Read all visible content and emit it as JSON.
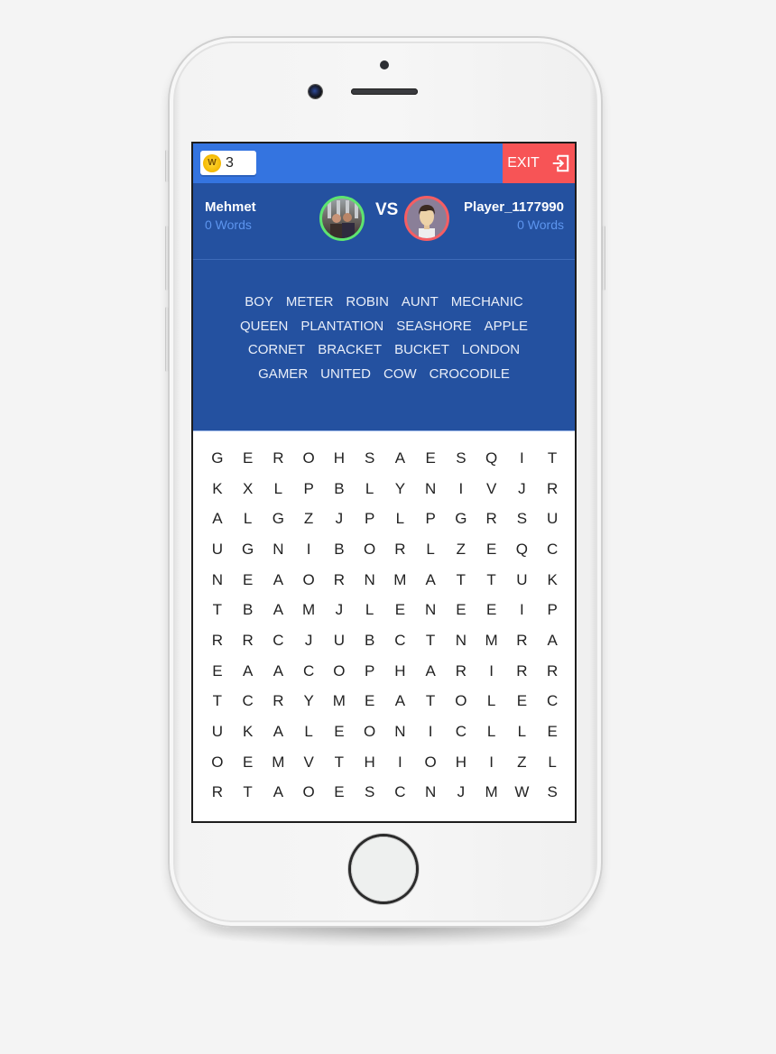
{
  "topbar": {
    "coins": "3",
    "coin_icon_letter": "W",
    "exit_label": "EXIT"
  },
  "players": {
    "left": {
      "name": "Mehmet",
      "words": "0 Words",
      "ring_color": "#5ee470"
    },
    "vs_label": "VS",
    "right": {
      "name": "Player_1177990",
      "words": "0 Words",
      "ring_color": "#f55e63"
    }
  },
  "word_list": [
    [
      "BOY",
      "METER",
      "ROBIN",
      "AUNT",
      "MECHANIC"
    ],
    [
      "QUEEN",
      "PLANTATION",
      "SEASHORE",
      "APPLE"
    ],
    [
      "CORNET",
      "BRACKET",
      "BUCKET",
      "LONDON"
    ],
    [
      "GAMER",
      "UNITED",
      "COW",
      "CROCODILE"
    ]
  ],
  "grid": [
    [
      "G",
      "E",
      "R",
      "O",
      "H",
      "S",
      "A",
      "E",
      "S",
      "Q",
      "I",
      "T"
    ],
    [
      "K",
      "X",
      "L",
      "P",
      "B",
      "L",
      "Y",
      "N",
      "I",
      "V",
      "J",
      "R"
    ],
    [
      "A",
      "L",
      "G",
      "Z",
      "J",
      "P",
      "L",
      "P",
      "G",
      "R",
      "S",
      "U"
    ],
    [
      "U",
      "G",
      "N",
      "I",
      "B",
      "O",
      "R",
      "L",
      "Z",
      "E",
      "Q",
      "C"
    ],
    [
      "N",
      "E",
      "A",
      "O",
      "R",
      "N",
      "M",
      "A",
      "T",
      "T",
      "U",
      "K"
    ],
    [
      "T",
      "B",
      "A",
      "M",
      "J",
      "L",
      "E",
      "N",
      "E",
      "E",
      "I",
      "P"
    ],
    [
      "R",
      "R",
      "C",
      "J",
      "U",
      "B",
      "C",
      "T",
      "N",
      "M",
      "R",
      "A"
    ],
    [
      "E",
      "A",
      "A",
      "C",
      "O",
      "P",
      "H",
      "A",
      "R",
      "I",
      "R",
      "R"
    ],
    [
      "T",
      "C",
      "R",
      "Y",
      "M",
      "E",
      "A",
      "T",
      "O",
      "L",
      "E",
      "C"
    ],
    [
      "U",
      "K",
      "A",
      "L",
      "E",
      "O",
      "N",
      "I",
      "C",
      "L",
      "L",
      "E"
    ],
    [
      "O",
      "E",
      "M",
      "V",
      "T",
      "H",
      "I",
      "O",
      "H",
      "I",
      "Z",
      "L"
    ],
    [
      "R",
      "T",
      "A",
      "O",
      "E",
      "S",
      "C",
      "N",
      "J",
      "M",
      "W",
      "S"
    ]
  ],
  "colors": {
    "topbar": "#3474e0",
    "panel": "#2451a0",
    "exit": "#f75456",
    "words_count": "#5d95ee"
  }
}
